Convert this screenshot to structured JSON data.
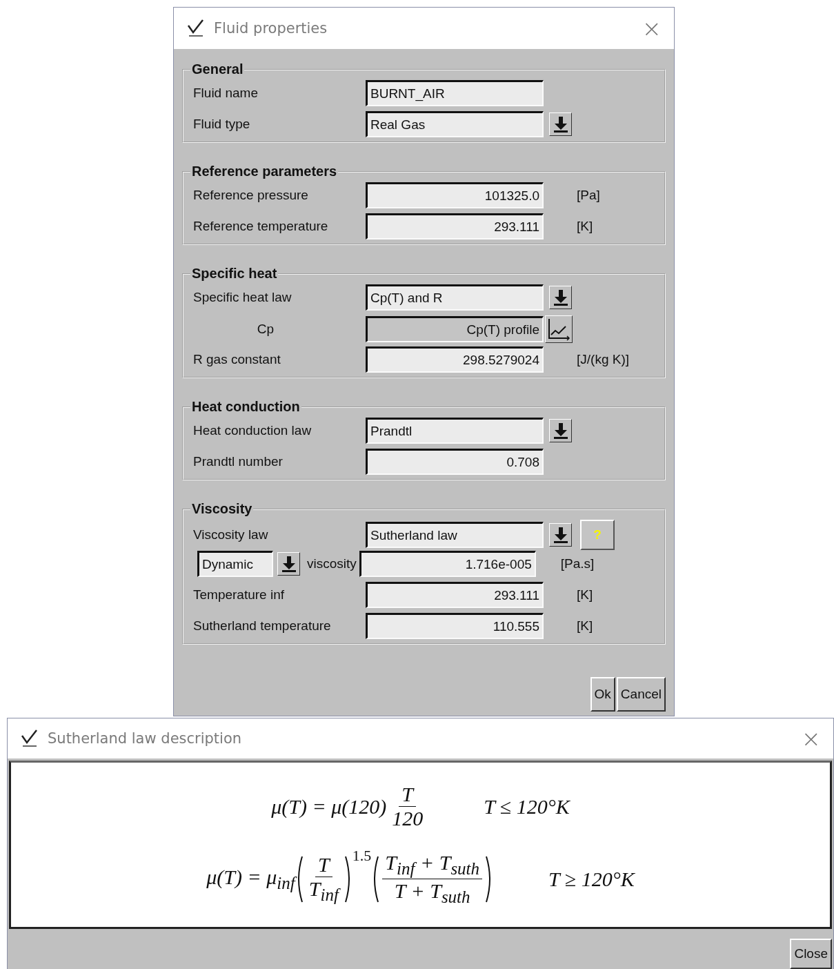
{
  "fluid_dialog": {
    "title": "Fluid properties",
    "close": "×",
    "sections": [
      {
        "title": "General",
        "rows": [
          {
            "kind": "text",
            "label": "Fluid name",
            "value": "BURNT_AIR"
          },
          {
            "kind": "combo",
            "label": "Fluid type",
            "value": "Real Gas"
          }
        ]
      },
      {
        "title": "Reference parameters",
        "rows": [
          {
            "kind": "number",
            "label": "Reference pressure",
            "value": "101325.0",
            "unit": "[Pa]"
          },
          {
            "kind": "number",
            "label": "Reference temperature",
            "value": "293.111",
            "unit": "[K]"
          }
        ]
      },
      {
        "title": "Specific heat",
        "rows": [
          {
            "kind": "combo",
            "label": "Specific heat law",
            "value": "Cp(T) and R"
          },
          {
            "kind": "profile",
            "label": "Cp",
            "value": "Cp(T) profile"
          },
          {
            "kind": "number",
            "label": "R gas constant",
            "value": "298.5279024",
            "unit": "[J/(kg K)]"
          }
        ]
      },
      {
        "title": "Heat conduction",
        "rows": [
          {
            "kind": "combo",
            "label": "Heat conduction law",
            "value": "Prandtl"
          },
          {
            "kind": "number",
            "label": "Prandtl number",
            "value": "0.708"
          }
        ]
      },
      {
        "title": "Viscosity",
        "rows": [
          {
            "kind": "combo",
            "label": "Viscosity law",
            "value": "Sutherland law",
            "help": "?"
          },
          {
            "kind": "mode",
            "mode": "Dynamic",
            "label": "viscosity",
            "value": "1.716e-005",
            "unit": "[Pa.s]"
          },
          {
            "kind": "number",
            "label": "Temperature inf",
            "value": "293.111",
            "unit": "[K]"
          },
          {
            "kind": "number",
            "label": "Sutherland temperature",
            "value": "110.555",
            "unit": "[K]"
          }
        ]
      }
    ],
    "buttons": [
      "Ok",
      "Cancel"
    ]
  },
  "law_dialog": {
    "title": "Sutherland law description",
    "close": "×",
    "formulas": [
      {
        "terms": [
          {
            "kind": "text",
            "text": "μ(T) = μ(120)"
          },
          {
            "kind": "frac",
            "num": "T",
            "den": "120"
          }
        ],
        "condition": "T ≤ 120°K"
      },
      {
        "terms": [
          {
            "kind": "text",
            "text": "μ(T) = μ$_{inf}$"
          },
          {
            "kind": "lparen"
          },
          {
            "kind": "frac",
            "num": "T",
            "den": "T$_{inf}$"
          },
          {
            "kind": "rparen"
          },
          {
            "kind": "sup",
            "text": "1.5"
          },
          {
            "kind": "lparen"
          },
          {
            "kind": "frac",
            "num": "T$_{inf}$ + T$_{suth}$",
            "den": "T + T$_{suth}$"
          },
          {
            "kind": "rparen"
          }
        ],
        "condition": "T ≥ 120°K"
      }
    ],
    "buttons": [
      "Close"
    ]
  }
}
